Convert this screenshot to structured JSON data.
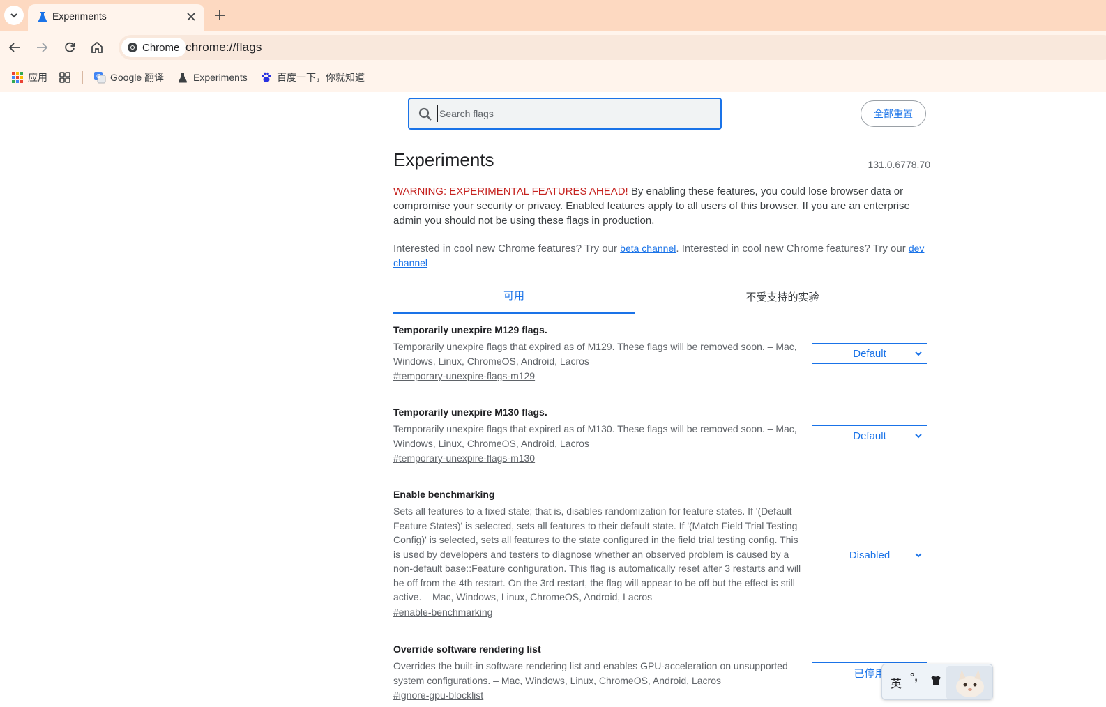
{
  "browser": {
    "tab": {
      "title": "Experiments"
    },
    "omnibox": {
      "site_chip": "Chrome",
      "url": "chrome://flags"
    },
    "bookmarks": [
      {
        "label": "应用",
        "icon": "apps-grid-icon"
      },
      {
        "label": "",
        "icon": "tab-groups-icon"
      },
      {
        "label": "Google 翻译",
        "icon": "google-translate-icon"
      },
      {
        "label": "Experiments",
        "icon": "flask-icon"
      },
      {
        "label": "百度一下，你就知道",
        "icon": "baidu-paw-icon"
      }
    ]
  },
  "header": {
    "search_placeholder": "Search flags",
    "reset_all_label": "全部重置"
  },
  "main": {
    "title": "Experiments",
    "version": "131.0.6778.70",
    "warning_prefix": "WARNING: EXPERIMENTAL FEATURES AHEAD!",
    "warning_text": " By enabling these features, you could lose browser data or compromise your security or privacy. Enabled features apply to all users of this browser. If you are an enterprise admin you should not be using these flags in production.",
    "channels_text_1": "Interested in cool new Chrome features? Try our ",
    "beta_link": "beta channel",
    "channels_text_2": ". Interested in cool new Chrome features? Try our ",
    "dev_link": "dev channel",
    "tabs": [
      {
        "label": "可用",
        "active": true
      },
      {
        "label": "不受支持的实验",
        "active": false
      }
    ],
    "experiments": [
      {
        "name": "Temporarily unexpire M129 flags.",
        "description": "Temporarily unexpire flags that expired as of M129. These flags will be removed soon. – Mac, Windows, Linux, ChromeOS, Android, Lacros",
        "link": "#temporary-unexpire-flags-m129",
        "value": "Default"
      },
      {
        "name": "Temporarily unexpire M130 flags.",
        "description": "Temporarily unexpire flags that expired as of M130. These flags will be removed soon. – Mac, Windows, Linux, ChromeOS, Android, Lacros",
        "link": "#temporary-unexpire-flags-m130",
        "value": "Default"
      },
      {
        "name": "Enable benchmarking",
        "description": "Sets all features to a fixed state; that is, disables randomization for feature states. If '(Default Feature States)' is selected, sets all features to their default state. If '(Match Field Trial Testing Config)' is selected, sets all features to the state configured in the field trial testing config. This is used by developers and testers to diagnose whether an observed problem is caused by a non-default base::Feature configuration. This flag is automatically reset after 3 restarts and will be off from the 4th restart. On the 3rd restart, the flag will appear to be off but the effect is still active. – Mac, Windows, Linux, ChromeOS, Android, Lacros",
        "link": "#enable-benchmarking",
        "value": "Disabled"
      },
      {
        "name": "Override software rendering list",
        "description": "Overrides the built-in software rendering list and enables GPU-acceleration on unsupported system configurations. – Mac, Windows, Linux, ChromeOS, Android, Lacros",
        "link": "#ignore-gpu-blocklist",
        "value": "已停用"
      }
    ]
  },
  "ime": {
    "language": "英",
    "punctuation": "°,"
  },
  "colors": {
    "accent": "#1a73e8",
    "warning": "#c5221f",
    "tabstrip": "#fdd9c1",
    "toolbar": "#fff4ec"
  }
}
